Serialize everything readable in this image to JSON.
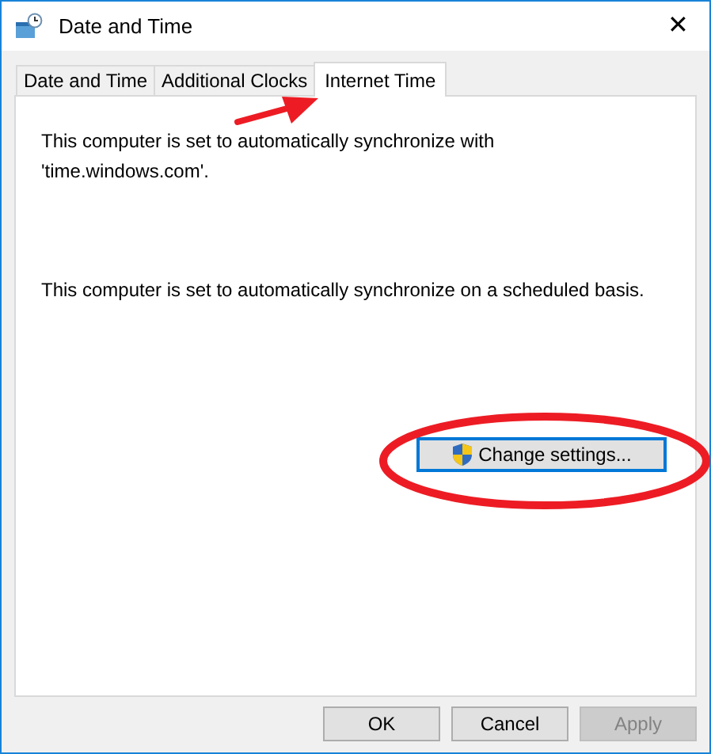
{
  "window": {
    "title": "Date and Time",
    "close": "✕"
  },
  "tabs": [
    {
      "label": "Date and Time",
      "selected": false
    },
    {
      "label": "Additional Clocks",
      "selected": false
    },
    {
      "label": "Internet Time",
      "selected": true
    }
  ],
  "panel": {
    "paragraphs": [
      "This computer is set to automatically synchronize with 'time.windows.com'.",
      "This computer is set to automatically synchronize on a scheduled basis."
    ],
    "change_settings": "Change settings..."
  },
  "buttons": [
    {
      "label": "OK",
      "disabled": false
    },
    {
      "label": "Cancel",
      "disabled": false
    },
    {
      "label": "Apply",
      "disabled": true
    }
  ]
}
